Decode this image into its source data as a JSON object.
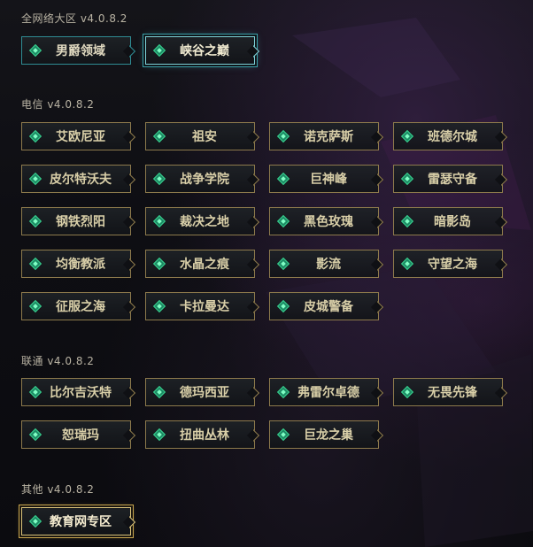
{
  "sections": {
    "all": {
      "title": "全网络大区  v4.0.8.2",
      "buttons": [
        "男爵领域",
        "峡谷之巅"
      ]
    },
    "telecom": {
      "title": "电信  v4.0.8.2",
      "buttons": [
        "艾欧尼亚",
        "祖安",
        "诺克萨斯",
        "班德尔城",
        "皮尔特沃夫",
        "战争学院",
        "巨神峰",
        "雷瑟守备",
        "钢铁烈阳",
        "裁决之地",
        "黑色玫瑰",
        "暗影岛",
        "均衡教派",
        "水晶之痕",
        "影流",
        "守望之海",
        "征服之海",
        "卡拉曼达",
        "皮城警备"
      ]
    },
    "unicom": {
      "title": "联通  v4.0.8.2",
      "buttons": [
        "比尔吉沃特",
        "德玛西亚",
        "弗雷尔卓德",
        "无畏先锋",
        "恕瑞玛",
        "扭曲丛林",
        "巨龙之巢"
      ]
    },
    "other": {
      "title": "其他  v4.0.8.2",
      "buttons": [
        "教育网专区"
      ]
    }
  },
  "colors": {
    "gold_border": "#8d7a4c",
    "teal_border": "#2f8c94",
    "gem_green": "#3ad08f"
  }
}
